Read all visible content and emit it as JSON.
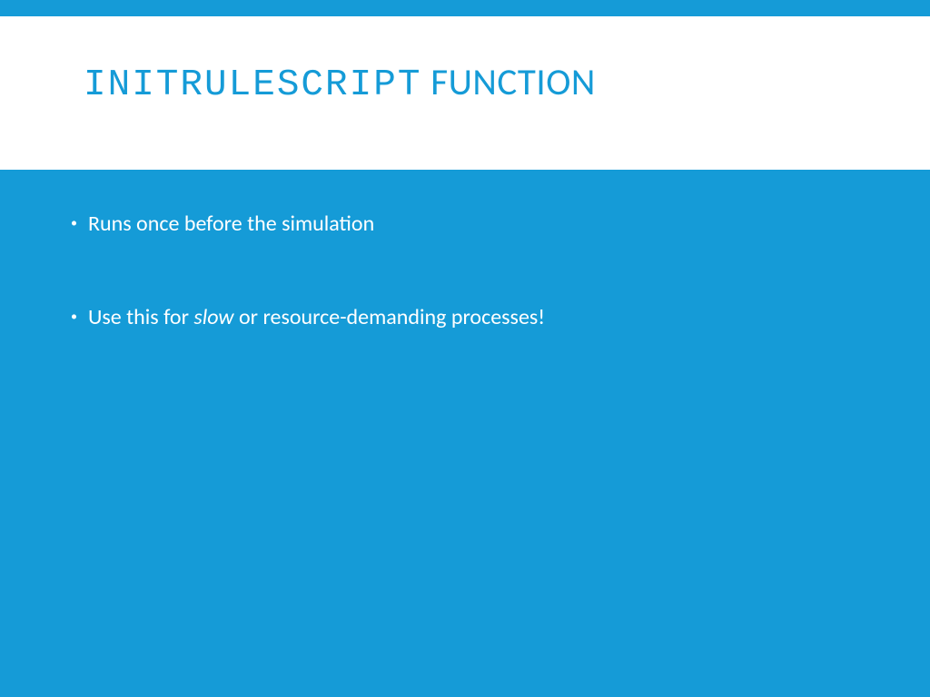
{
  "title": {
    "code": "INITRULESCRIPT",
    "func": " FUNCTION"
  },
  "bullets": [
    {
      "prefix": "Runs once before the simulation",
      "italic": "",
      "suffix": ""
    },
    {
      "prefix": "Use this for ",
      "italic": "slow",
      "suffix": " or resource-demanding processes!"
    }
  ]
}
